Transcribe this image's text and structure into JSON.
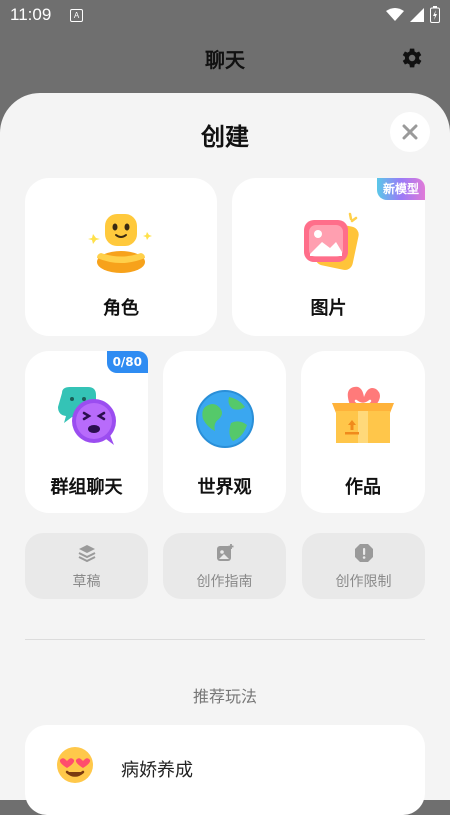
{
  "status_bar": {
    "time": "11:09",
    "notification_icon": "A"
  },
  "header": {
    "title": "聊天"
  },
  "sheet": {
    "title": "创建",
    "cards": {
      "role": {
        "label": "角色"
      },
      "image": {
        "label": "图片",
        "badge": "新模型"
      },
      "group_chat": {
        "label": "群组聊天",
        "badge": "0/80"
      },
      "worldview": {
        "label": "世界观"
      },
      "works": {
        "label": "作品"
      }
    },
    "small_cards": {
      "drafts": {
        "label": "草稿"
      },
      "guide": {
        "label": "创作指南"
      },
      "limits": {
        "label": "创作限制"
      }
    },
    "recommend": {
      "title": "推荐玩法",
      "items": [
        {
          "label": "病娇养成"
        }
      ]
    }
  },
  "colors": {
    "image_badge": "#6f9dfb",
    "group_badge": "#2f8cf2",
    "sheet_background": "#f4f4f4",
    "overlay": "#6f6f6f"
  }
}
